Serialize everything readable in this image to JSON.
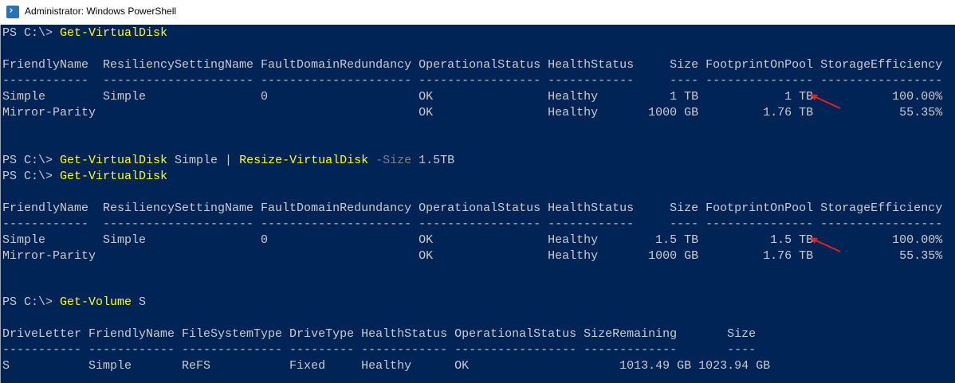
{
  "window": {
    "title": "Administrator: Windows PowerShell",
    "icon": "powershell-icon"
  },
  "colors": {
    "console_bg": "#012456",
    "text": "#cccccc",
    "command": "#ffff00",
    "parameter": "#808080",
    "arrow": "#e0231c"
  },
  "console": {
    "block1": {
      "prompt": "PS C:\\> ",
      "cmd": "Get-VirtualDisk",
      "header": "FriendlyName  ResiliencySettingName FaultDomainRedundancy OperationalStatus HealthStatus     Size FootprintOnPool StorageEfficiency",
      "dashes": "------------  --------------------- --------------------- ----------------- ------------     ---- --------------- -----------------",
      "row1": "Simple        Simple                0                     OK                Healthy          1 TB            1 TB           100.00%",
      "row2": "Mirror-Parity                                             OK                Healthy       1000 GB         1.76 TB            55.35%"
    },
    "block2": {
      "prompt": "PS C:\\> ",
      "cmd1": "Get-VirtualDisk",
      "arg1": " Simple | ",
      "cmd2": "Resize-VirtualDisk",
      "sp": " ",
      "param": "-Size",
      "arg2": " 1.5TB"
    },
    "block3": {
      "prompt": "PS C:\\> ",
      "cmd": "Get-VirtualDisk",
      "header": "FriendlyName  ResiliencySettingName FaultDomainRedundancy OperationalStatus HealthStatus     Size FootprintOnPool StorageEfficiency",
      "dashes": "------------  --------------------- --------------------- ----------------- ------------     ---- --------------- -----------------",
      "row1": "Simple        Simple                0                     OK                Healthy        1.5 TB          1.5 TB           100.00%",
      "row2": "Mirror-Parity                                             OK                Healthy       1000 GB         1.76 TB            55.35%"
    },
    "block4": {
      "prompt": "PS C:\\> ",
      "cmd": "Get-Volume",
      "arg": " S",
      "header": "DriveLetter FriendlyName FileSystemType DriveType HealthStatus OperationalStatus SizeRemaining       Size",
      "dashes": "----------- ------------ -------------- --------- ------------ ----------------- -------------       ----",
      "row1": "S           Simple       ReFS           Fixed     Healthy      OK                     1013.49 GB 1023.94 GB"
    }
  }
}
